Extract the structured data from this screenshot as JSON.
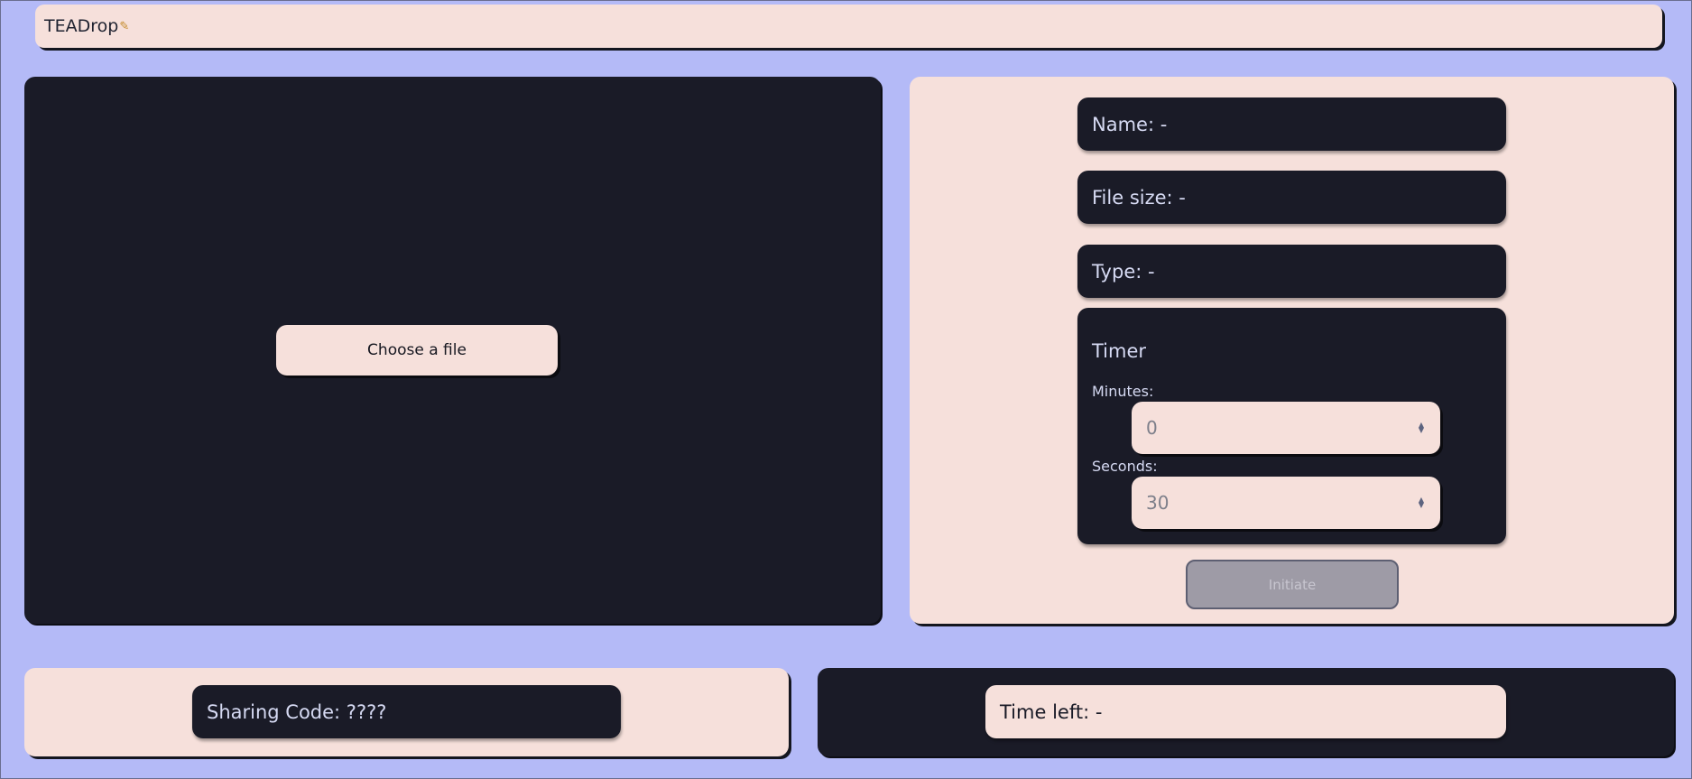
{
  "header": {
    "title": "TEADrop",
    "logo_icon": "bird-icon"
  },
  "drop_zone": {
    "choose_label": "Choose a file"
  },
  "file_info": {
    "name": "Name: -",
    "size": "File size: -",
    "type": "Type: -"
  },
  "timer": {
    "title": "Timer",
    "minutes_label": "Minutes:",
    "minutes_value": "0",
    "seconds_label": "Seconds:",
    "seconds_value": "30"
  },
  "actions": {
    "initiate_label": "Initiate"
  },
  "sharing": {
    "code_text": "Sharing Code: ????"
  },
  "status": {
    "time_left": "Time left: -"
  },
  "colors": {
    "background": "#b4baf7",
    "light": "#f6e0db",
    "dark": "#1a1b27",
    "disabled": "#9e9ba6"
  }
}
